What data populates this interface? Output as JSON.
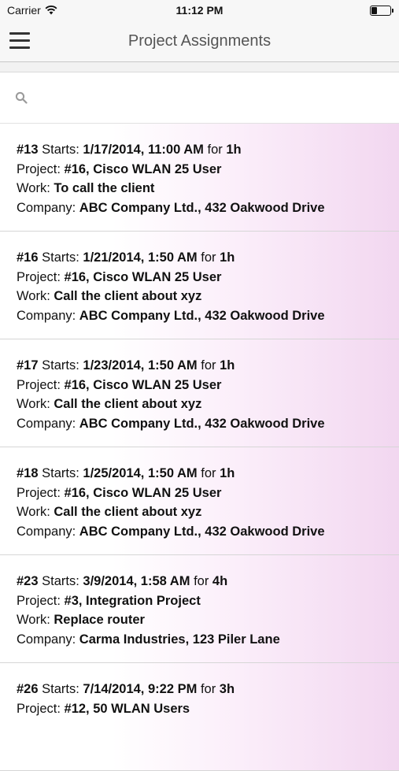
{
  "status_bar": {
    "carrier": "Carrier",
    "time": "11:12 PM",
    "battery_level": 0.3
  },
  "nav": {
    "title": "Project Assignments"
  },
  "search": {
    "placeholder": "",
    "value": ""
  },
  "labels": {
    "starts": "Starts:",
    "for": "for",
    "project": "Project:",
    "work": "Work:",
    "company": "Company:"
  },
  "assignments": [
    {
      "id": "#13",
      "start": "1/17/2014, 11:00 AM",
      "duration": "1h",
      "project": "#16, Cisco WLAN 25 User",
      "work": "To call the client",
      "company": "ABC Company Ltd., 432 Oakwood Drive"
    },
    {
      "id": "#16",
      "start": "1/21/2014, 1:50 AM",
      "duration": "1h",
      "project": "#16, Cisco WLAN 25 User",
      "work": "Call the client about xyz",
      "company": "ABC Company Ltd., 432 Oakwood Drive"
    },
    {
      "id": "#17",
      "start": "1/23/2014, 1:50 AM",
      "duration": "1h",
      "project": "#16, Cisco WLAN 25 User",
      "work": "Call the client about xyz",
      "company": "ABC Company Ltd., 432 Oakwood Drive"
    },
    {
      "id": "#18",
      "start": "1/25/2014, 1:50 AM",
      "duration": "1h",
      "project": "#16, Cisco WLAN 25 User",
      "work": "Call the client about xyz",
      "company": "ABC Company Ltd., 432 Oakwood Drive"
    },
    {
      "id": "#23",
      "start": "3/9/2014, 1:58 AM",
      "duration": "4h",
      "project": "#3, Integration Project",
      "work": "Replace router",
      "company": "Carma Industries, 123 Piler Lane"
    },
    {
      "id": "#26",
      "start": "7/14/2014, 9:22 PM",
      "duration": "3h",
      "project": "#12, 50 WLAN Users",
      "work": "",
      "company": ""
    }
  ],
  "colors": {
    "row_gradient_end": "#f2d7f0",
    "separator": "#d6d6d6",
    "nav_background": "#f7f7f7"
  }
}
